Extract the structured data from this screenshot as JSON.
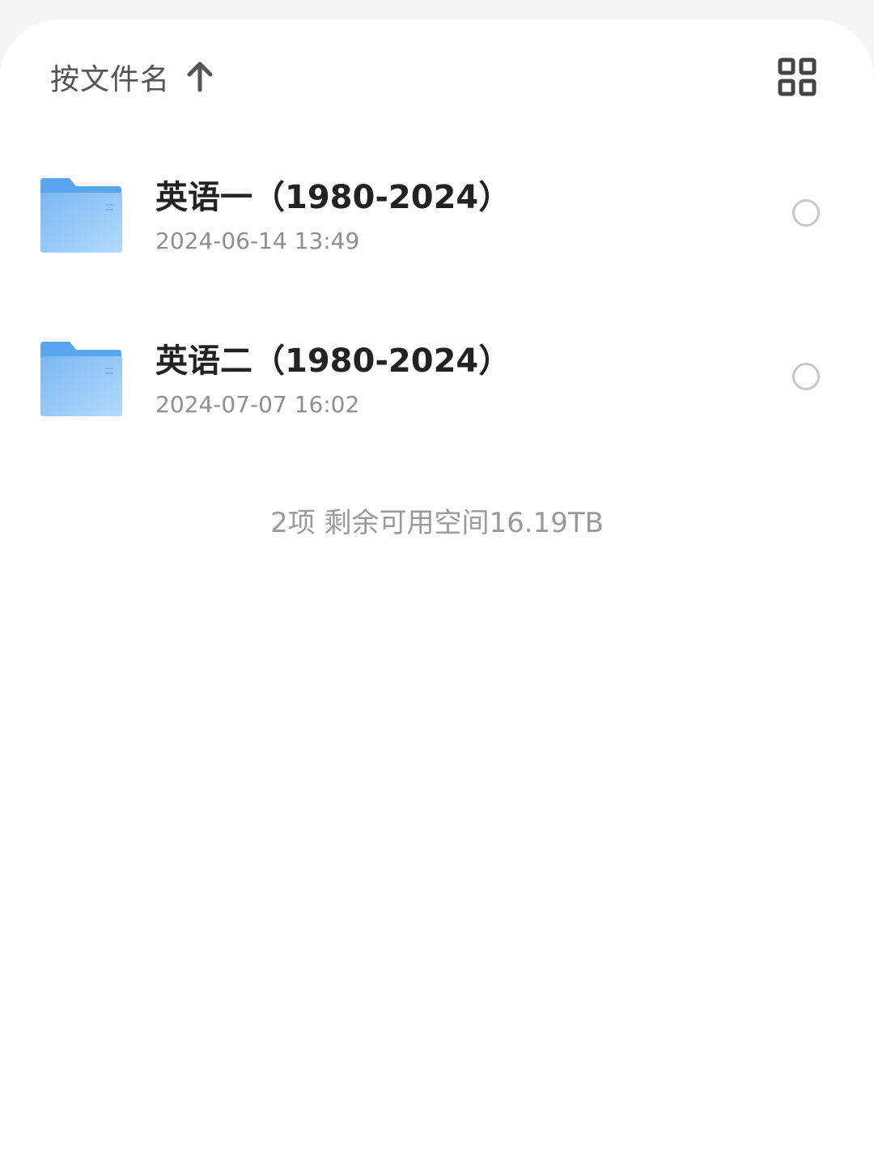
{
  "sort": {
    "label": "按文件名",
    "direction_icon": "arrow-up-icon"
  },
  "view_toggle": {
    "icon": "grid-view-icon"
  },
  "files": [
    {
      "name": "英语一（1980-2024）",
      "modified": "2024-06-14 13:49",
      "icon": "folder-icon",
      "selected": false
    },
    {
      "name": "英语二（1980-2024）",
      "modified": "2024-07-07 16:02",
      "icon": "folder-icon",
      "selected": false
    }
  ],
  "summary": "2项 剩余可用空间16.19TB",
  "colors": {
    "folder_back": "#5aa6ee",
    "folder_front": "#8ec6f8",
    "text_primary": "#222222",
    "text_secondary": "#8f8f8f"
  }
}
